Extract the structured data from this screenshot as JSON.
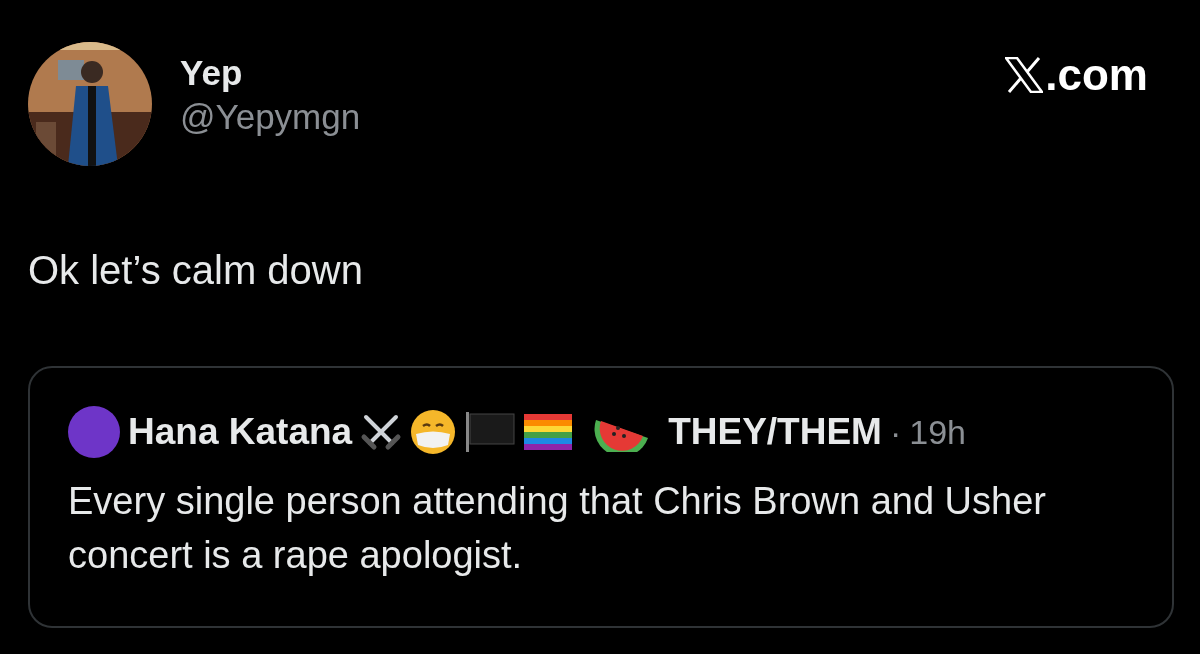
{
  "author": {
    "name": "Yep",
    "handle": "@Yepymgn"
  },
  "brand": {
    "suffix": ".com"
  },
  "text": "Ok let’s calm down",
  "quote": {
    "name": "Hana Katana",
    "pronouns": "THEY/THEM",
    "separator": "·",
    "time": "19h",
    "text": "Every single person attending that Chris Brown and Usher concert is a rape apologist."
  }
}
